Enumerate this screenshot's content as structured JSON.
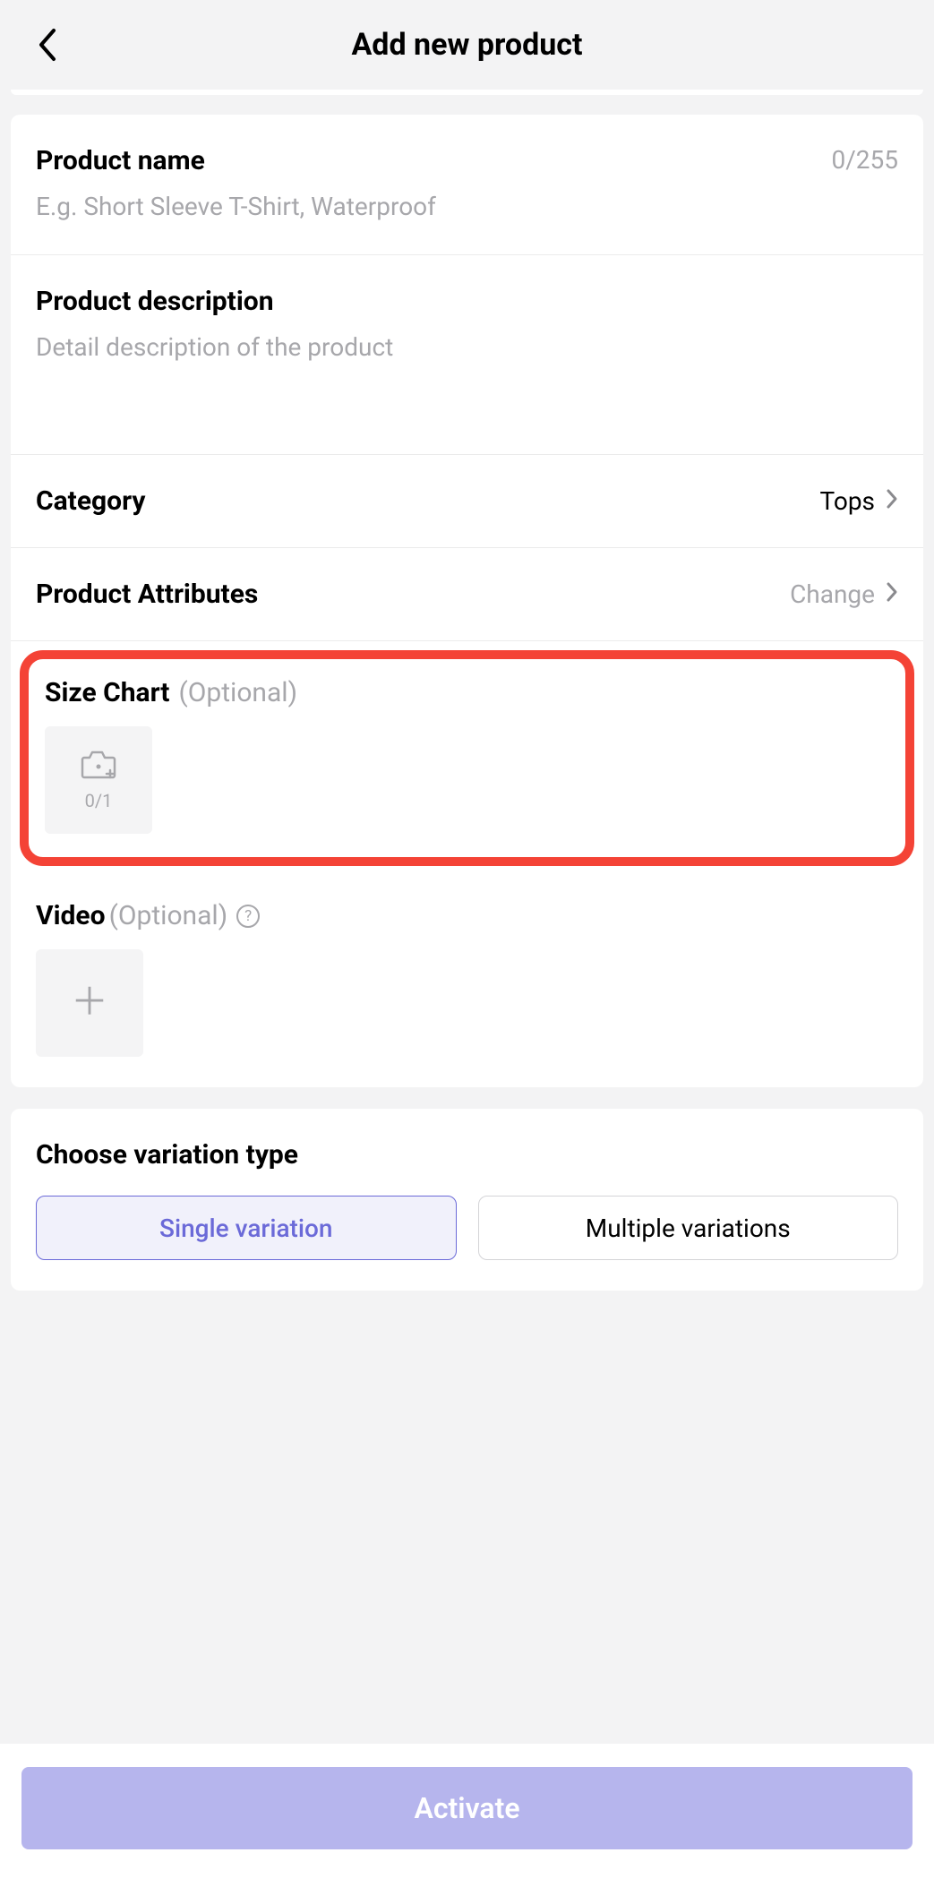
{
  "header": {
    "title": "Add new product"
  },
  "product_name": {
    "label": "Product name",
    "counter": "0/255",
    "placeholder": "E.g. Short Sleeve T-Shirt, Waterproof"
  },
  "product_description": {
    "label": "Product description",
    "placeholder": "Detail description of the product"
  },
  "category": {
    "label": "Category",
    "value": "Tops"
  },
  "product_attributes": {
    "label": "Product Attributes",
    "action": "Change"
  },
  "size_chart": {
    "label": "Size Chart",
    "optional": "(Optional)",
    "counter": "0/1"
  },
  "video": {
    "label": "Video",
    "optional": "(Optional)"
  },
  "variation": {
    "label": "Choose variation type",
    "single": "Single variation",
    "multiple": "Multiple variations"
  },
  "footer": {
    "activate": "Activate"
  }
}
